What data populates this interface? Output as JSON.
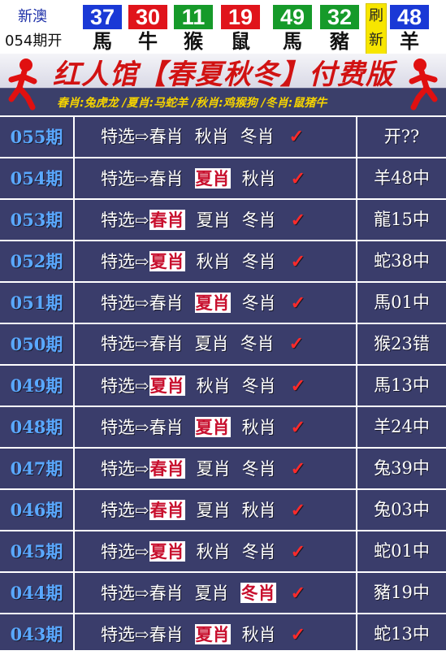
{
  "header": {
    "region": "新澳",
    "draw_label": "054期开",
    "balls": [
      {
        "num": "37",
        "zodiac": "馬",
        "color": "#1a39d6"
      },
      {
        "num": "30",
        "zodiac": "牛",
        "color": "#e0141b"
      },
      {
        "num": "11",
        "zodiac": "猴",
        "color": "#169a2a"
      },
      {
        "num": "19",
        "zodiac": "鼠",
        "color": "#e0141b"
      },
      {
        "num": "49",
        "zodiac": "馬",
        "color": "#169a2a"
      },
      {
        "num": "32",
        "zodiac": "豬",
        "color": "#169a2a"
      },
      {
        "num": "48",
        "zodiac": "羊",
        "color": "#1a39d6"
      }
    ],
    "refresh": [
      "刷",
      "新"
    ]
  },
  "banner": {
    "title": "红人馆【春夏秋冬】付费版",
    "subtitle": "春肖:兔虎龙 /夏肖:马蛇羊 /秋肖:鸡猴狗 /冬肖:鼠猪牛"
  },
  "rows": [
    {
      "period": "055期",
      "lead": "特选⇨",
      "picks": [
        "春肖",
        "秋肖",
        "冬肖"
      ],
      "hit": -1,
      "result": "开??"
    },
    {
      "period": "054期",
      "lead": "特选⇨",
      "picks": [
        "春肖",
        "夏肖",
        "秋肖"
      ],
      "hit": 1,
      "result": "羊48中"
    },
    {
      "period": "053期",
      "lead": "特选⇨",
      "picks": [
        "春肖",
        "夏肖",
        "冬肖"
      ],
      "hit": 0,
      "result": "龍15中"
    },
    {
      "period": "052期",
      "lead": "特选⇨",
      "picks": [
        "夏肖",
        "秋肖",
        "冬肖"
      ],
      "hit": 0,
      "result": "蛇38中"
    },
    {
      "period": "051期",
      "lead": "特选⇨",
      "picks": [
        "春肖",
        "夏肖",
        "冬肖"
      ],
      "hit": 1,
      "result": "馬01中"
    },
    {
      "period": "050期",
      "lead": "特选⇨",
      "picks": [
        "春肖",
        "夏肖",
        "冬肖"
      ],
      "hit": -1,
      "result": "猴23错"
    },
    {
      "period": "049期",
      "lead": "特选⇨",
      "picks": [
        "夏肖",
        "秋肖",
        "冬肖"
      ],
      "hit": 0,
      "result": "馬13中"
    },
    {
      "period": "048期",
      "lead": "特选⇨",
      "picks": [
        "春肖",
        "夏肖",
        "秋肖"
      ],
      "hit": 1,
      "result": "羊24中"
    },
    {
      "period": "047期",
      "lead": "特选⇨",
      "picks": [
        "春肖",
        "夏肖",
        "冬肖"
      ],
      "hit": 0,
      "result": "兔39中"
    },
    {
      "period": "046期",
      "lead": "特选⇨",
      "picks": [
        "春肖",
        "夏肖",
        "秋肖"
      ],
      "hit": 0,
      "result": "兔03中"
    },
    {
      "period": "045期",
      "lead": "特选⇨",
      "picks": [
        "夏肖",
        "秋肖",
        "冬肖"
      ],
      "hit": 0,
      "result": "蛇01中"
    },
    {
      "period": "044期",
      "lead": "特选⇨",
      "picks": [
        "春肖",
        "夏肖",
        "冬肖"
      ],
      "hit": 2,
      "result": "豬19中"
    },
    {
      "period": "043期",
      "lead": "特选⇨",
      "picks": [
        "春肖",
        "夏肖",
        "秋肖"
      ],
      "hit": 1,
      "result": "蛇13中"
    }
  ],
  "check_mark": "✓",
  "colors": {
    "table_bg": "#3a3d6b",
    "period_text": "#5aa8ff",
    "highlight_text": "#c8102e",
    "check": "#ff2a2a",
    "banner_title": "#d11212",
    "banner_subtitle": "#f5d300"
  }
}
